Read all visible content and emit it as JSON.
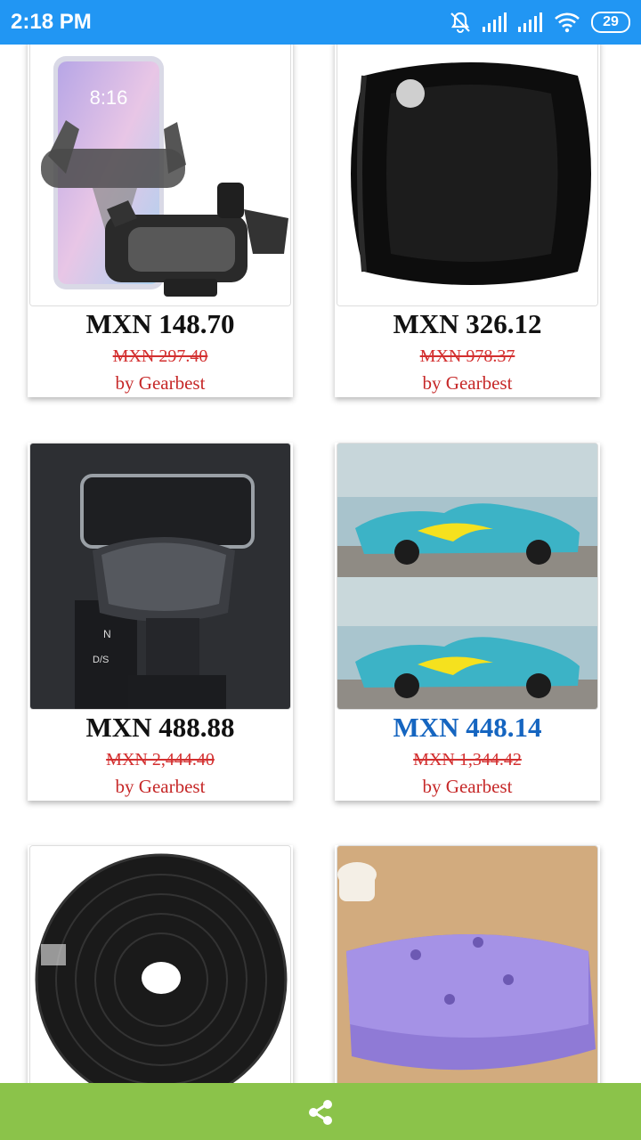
{
  "status_bar": {
    "time": "2:18 PM",
    "battery": "29",
    "icons": [
      "mute-alarm-icon",
      "signal-icon",
      "signal-icon",
      "wifi-icon",
      "battery-icon"
    ]
  },
  "products": [
    {
      "price": "MXN 148.70",
      "original_price": "MXN 297.40",
      "seller": "by Gearbest",
      "image": "phone-holder-image"
    },
    {
      "price": "MXN 326.12",
      "original_price": "MXN 978.37",
      "seller": "by Gearbest",
      "image": "neck-pillow-image"
    },
    {
      "price": "MXN 488.88",
      "original_price": "MXN 2,444.40",
      "seller": "by Gearbest",
      "image": "gear-shift-cover-image"
    },
    {
      "price": "MXN 448.14",
      "original_price": "MXN 1,344.42",
      "seller": "by Gearbest",
      "image": "flame-decal-car-image"
    },
    {
      "image": "rubber-seal-strip-image"
    },
    {
      "image": "purple-cushion-image"
    }
  ],
  "colors": {
    "status_bar": "#2196f3",
    "bottom_bar": "#8bc34a",
    "price_highlight": "#1565c0",
    "old_price": "#d32f2f"
  },
  "bottom_bar": {
    "icon": "share-icon"
  }
}
